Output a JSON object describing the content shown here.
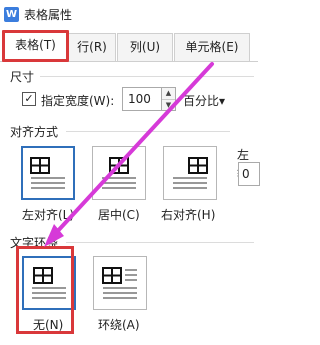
{
  "window": {
    "app_icon": "W",
    "title": "表格属性"
  },
  "tabs": [
    {
      "label": "表格(T)",
      "active": true
    },
    {
      "label": "行(R)",
      "active": false
    },
    {
      "label": "列(U)",
      "active": false
    },
    {
      "label": "单元格(E)",
      "active": false
    }
  ],
  "size": {
    "section_label": "尺寸",
    "checkbox_checked": true,
    "checkbox_mark": "✓",
    "checkbox_label": "指定宽度(W):",
    "width_value": "100",
    "unit": "百分比▾"
  },
  "alignment": {
    "section_label": "对齐方式",
    "options": [
      {
        "label": "左对齐(L)",
        "selected": true
      },
      {
        "label": "居中(C)",
        "selected": false
      },
      {
        "label": "右对齐(H)",
        "selected": false
      }
    ],
    "indent_label_partial": "左缩",
    "indent_value_partial": "0"
  },
  "wrapping": {
    "section_label": "文字环绕",
    "options": [
      {
        "label": "无(N)",
        "selected": true
      },
      {
        "label": "环绕(A)",
        "selected": false
      }
    ]
  },
  "annotation": {
    "highlight_color": "#d9383a",
    "arrow_color": "#d63ad8"
  }
}
